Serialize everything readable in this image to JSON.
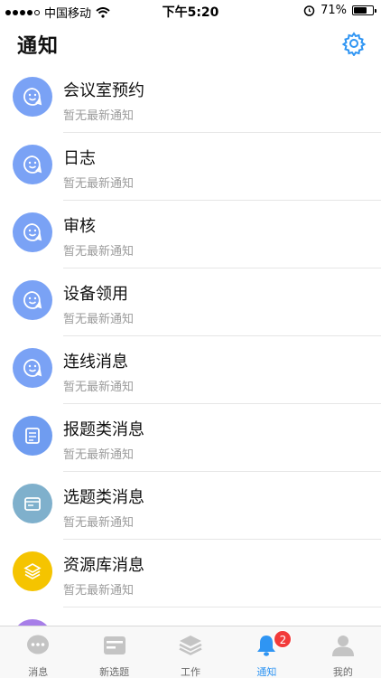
{
  "status_bar": {
    "carrier": "中国移动",
    "time": "下午5:20",
    "battery": "71%",
    "battery_level": 0.71
  },
  "header": {
    "title": "通知",
    "settings_icon": "gear-icon"
  },
  "notifications": [
    {
      "title": "会议室预约",
      "subtitle": "暂无最新通知",
      "icon": "smile-icon",
      "color": "#7aa2f5"
    },
    {
      "title": "日志",
      "subtitle": "暂无最新通知",
      "icon": "smile-icon",
      "color": "#7aa2f5"
    },
    {
      "title": "审核",
      "subtitle": "暂无最新通知",
      "icon": "smile-icon",
      "color": "#7aa2f5"
    },
    {
      "title": "设备领用",
      "subtitle": "暂无最新通知",
      "icon": "smile-icon",
      "color": "#7aa2f5"
    },
    {
      "title": "连线消息",
      "subtitle": "暂无最新通知",
      "icon": "smile-icon",
      "color": "#7aa2f5"
    },
    {
      "title": "报题类消息",
      "subtitle": "暂无最新通知",
      "icon": "checklist-icon",
      "color": "#6f9cf0"
    },
    {
      "title": "选题类消息",
      "subtitle": "暂无最新通知",
      "icon": "card-icon",
      "color": "#7fb0cc"
    },
    {
      "title": "资源库消息",
      "subtitle": "暂无最新通知",
      "icon": "layers-icon",
      "color": "#f5c400"
    },
    {
      "title": "",
      "subtitle": "",
      "icon": "partial-icon",
      "color": "#a77ee8"
    }
  ],
  "tabbar": {
    "tabs": [
      {
        "label": "消息",
        "icon": "chat-bubble-icon"
      },
      {
        "label": "新选题",
        "icon": "card-icon"
      },
      {
        "label": "工作",
        "icon": "layers-icon"
      },
      {
        "label": "通知",
        "icon": "bell-icon",
        "badge": "2",
        "active": true
      },
      {
        "label": "我的",
        "icon": "person-icon"
      }
    ]
  },
  "colors": {
    "accent": "#2f95f3",
    "badge": "#f23a3a"
  }
}
